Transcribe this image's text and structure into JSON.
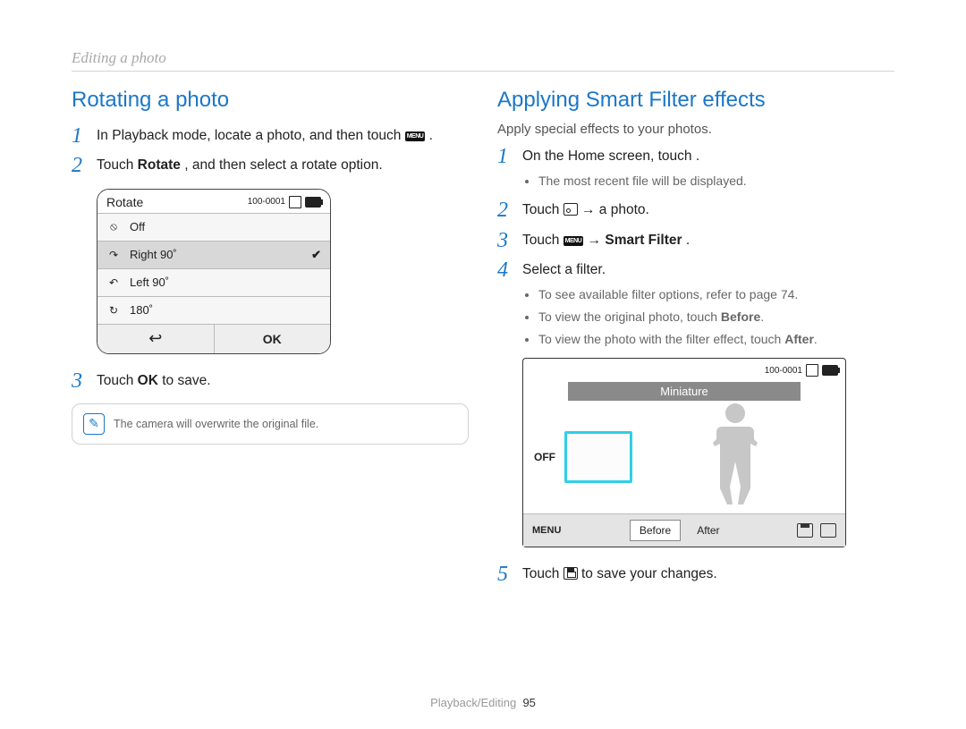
{
  "breadcrumb": "Editing a photo",
  "left": {
    "title": "Rotating a photo",
    "steps": {
      "s1_a": "In Playback mode, locate a photo, and then touch ",
      "s1_b": ".",
      "s2_a": "Touch ",
      "s2_bold": "Rotate",
      "s2_b": ", and then select a rotate option.",
      "s3_a": "Touch ",
      "s3_ok": "OK",
      "s3_b": " to save."
    },
    "note": "The camera will overwrite the original file.",
    "dialog": {
      "title": "Rotate",
      "code": "100-0001",
      "options": [
        "Off",
        "Right 90˚",
        "Left 90˚",
        "180˚"
      ],
      "selectedIndex": 1,
      "ok": "OK"
    }
  },
  "right": {
    "title": "Applying Smart Filter effects",
    "intro": "Apply special effects to your photos.",
    "steps": {
      "s1": "On the Home screen, touch      .",
      "s1_sub1": "The most recent file will be displayed.",
      "s2_a": "Touch ",
      "s2_arrow": " → a photo.",
      "s3_a": "Touch ",
      "s3_arrow": " → ",
      "s3_bold": "Smart Filter",
      "s3_dot": ".",
      "s4": "Select a filter.",
      "s4_sub1": "To see available filter options, refer to page 74.",
      "s4_sub2_a": "To view the original photo, touch ",
      "s4_sub2_bold": "Before",
      "s4_sub2_b": ".",
      "s4_sub3_a": "To view the photo with the filter effect, touch ",
      "s4_sub3_bold": "After",
      "s4_sub3_b": ".",
      "s5_a": "Touch ",
      "s5_b": " to save your changes."
    },
    "screen": {
      "code": "100-0001",
      "filterName": "Miniature",
      "off": "OFF",
      "menu": "MENU",
      "before": "Before",
      "after": "After"
    }
  },
  "footer": {
    "section": "Playback/Editing",
    "page": "95"
  },
  "icons": {
    "menu": "MENU"
  }
}
